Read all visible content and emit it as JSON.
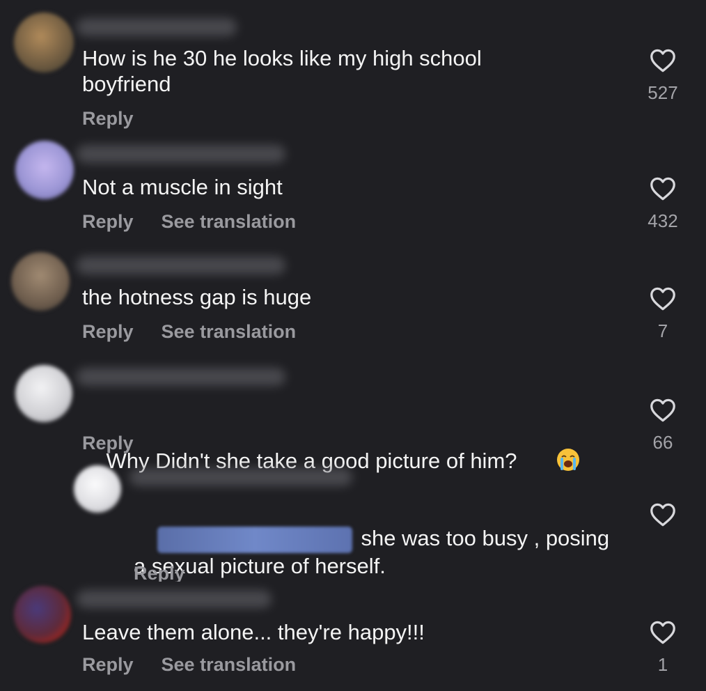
{
  "comments": [
    {
      "text": "How is he 30 he looks like my high school\nboyfriend",
      "reply_label": "Reply",
      "translate_label": "",
      "likes": "527",
      "avatar_color": "#8a6f4d"
    },
    {
      "text": "Not a muscle in sight",
      "reply_label": "Reply",
      "translate_label": "See translation",
      "likes": "432",
      "avatar_color": "#a9a2d8"
    },
    {
      "text": "the hotness gap is huge",
      "reply_label": "Reply",
      "translate_label": "See translation",
      "likes": "7",
      "avatar_color": "#7d6a58"
    },
    {
      "text": "Why Didn't she take a good picture of him?",
      "reply_label": "Reply",
      "translate_label": "",
      "likes": "66",
      "avatar_color": "#d8d8dc",
      "emoji": "loudly-crying-face-icon"
    },
    {
      "text_line1": "she was too busy , posing",
      "text_line2": "a sexual picture of herself.",
      "reply_label": "Reply",
      "likes": "",
      "avatar_color": "#e2e2e5",
      "is_reply": true
    },
    {
      "text": "Leave them alone... they're happy!!!",
      "reply_label": "Reply",
      "translate_label": "See translation",
      "likes": "1",
      "avatar_color": "#5a4a6e"
    }
  ],
  "colors": {
    "background": "#1f1f23",
    "text": "#f4f4f4",
    "secondary": "#9a9a9f"
  }
}
